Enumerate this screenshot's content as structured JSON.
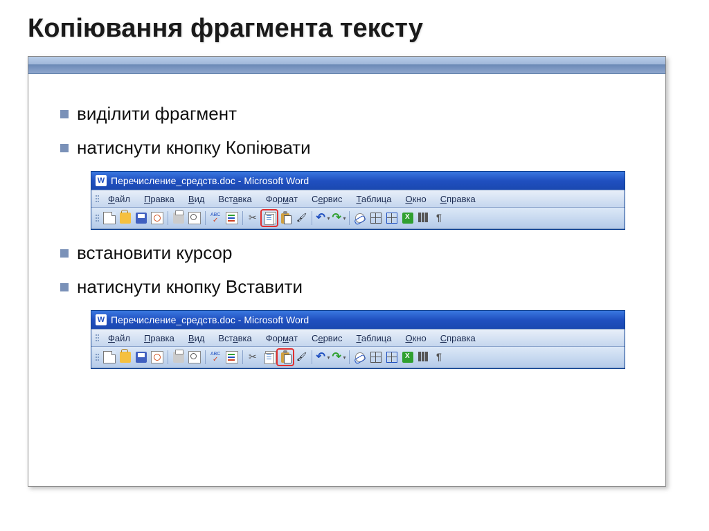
{
  "title": "Копіювання фрагмента тексту",
  "bullets": {
    "b1": "виділити фрагмент",
    "b2": "натиснути кнопку Копіювати",
    "b3": "встановити курсор",
    "b4": "натиснути кнопку Вставити"
  },
  "word": {
    "app_icon": "W",
    "window_title": "Перечисление_средств.doc - Microsoft Word",
    "menu": {
      "file": "Файл",
      "edit": "Правка",
      "view": "Вид",
      "insert": "Вставка",
      "format": "Формат",
      "tools": "Сервис",
      "table": "Таблица",
      "window": "Окно",
      "help": "Справка"
    }
  }
}
